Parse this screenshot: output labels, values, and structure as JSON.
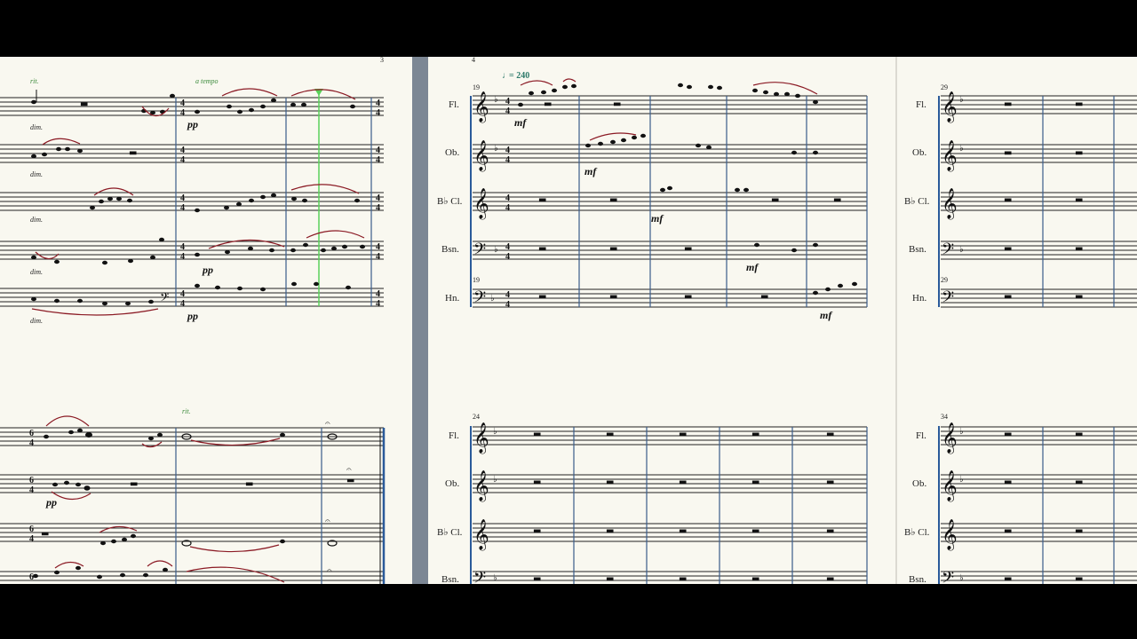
{
  "score": {
    "left_system": {
      "markings": {
        "rit_top": "rit.",
        "a_tempo": "a tempo",
        "rit_bottom": "rit."
      },
      "dynamics": [
        "dim.",
        "pp",
        "pp",
        "dim.",
        "dim.",
        "dim."
      ],
      "page_number": "3"
    },
    "middle_system": {
      "page_number": "4",
      "tempo_marking": "= 240",
      "instruments": [
        "Fl.",
        "Ob.",
        "B♭ Cl.",
        "Bsn.",
        "Hn."
      ],
      "measure_numbers": {
        "system_one": "19",
        "system_two": "24",
        "horn_line": "19"
      },
      "dynamics": [
        "mf",
        "mf",
        "mf",
        "mf",
        "mf"
      ]
    },
    "right_system": {
      "instruments": [
        "Fl.",
        "Ob.",
        "B♭ Cl.",
        "Bsn.",
        "Hn."
      ],
      "measure_numbers": {
        "system_one": "29",
        "system_two": "34",
        "horn_line": "29"
      }
    }
  },
  "colors": {
    "page": "#f9f8f0",
    "barline": "#3a5d8a",
    "slur": "#8b1a24",
    "playback_cursor": "#5ad15a",
    "tempo": "#2d7a6a",
    "divider": "#7c8794"
  }
}
